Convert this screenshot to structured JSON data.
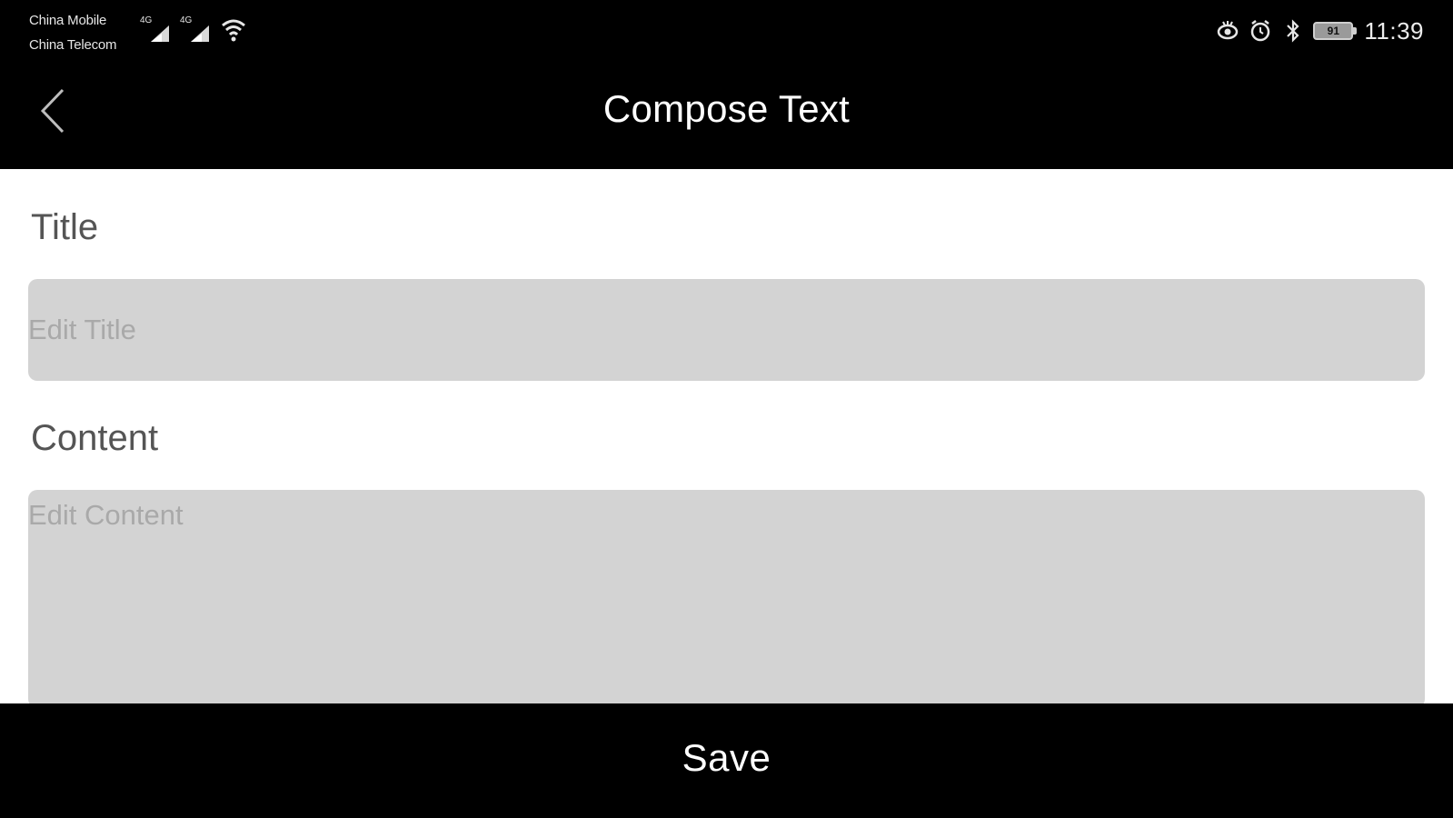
{
  "status_bar": {
    "carrier_1": "China Mobile",
    "carrier_2": "China Telecom",
    "network_type_1": "4G",
    "network_type_2": "4G",
    "battery_level": "91",
    "time": "11:39",
    "icons": [
      "signal-icon",
      "signal-icon",
      "wifi-icon",
      "eye-icon",
      "alarm-icon",
      "bluetooth-icon",
      "battery-icon"
    ]
  },
  "nav": {
    "title": "Compose Text",
    "back_icon": "chevron-left-icon"
  },
  "form": {
    "title_label": "Title",
    "title_placeholder": "Edit Title",
    "title_value": "",
    "content_label": "Content",
    "content_placeholder": "Edit Content",
    "content_value": ""
  },
  "footer": {
    "save_label": "Save"
  },
  "colors": {
    "bar_background": "#000000",
    "page_background": "#ffffff",
    "input_background": "#d3d3d3",
    "label_text": "#555555",
    "placeholder_text": "#a9a9a9"
  }
}
